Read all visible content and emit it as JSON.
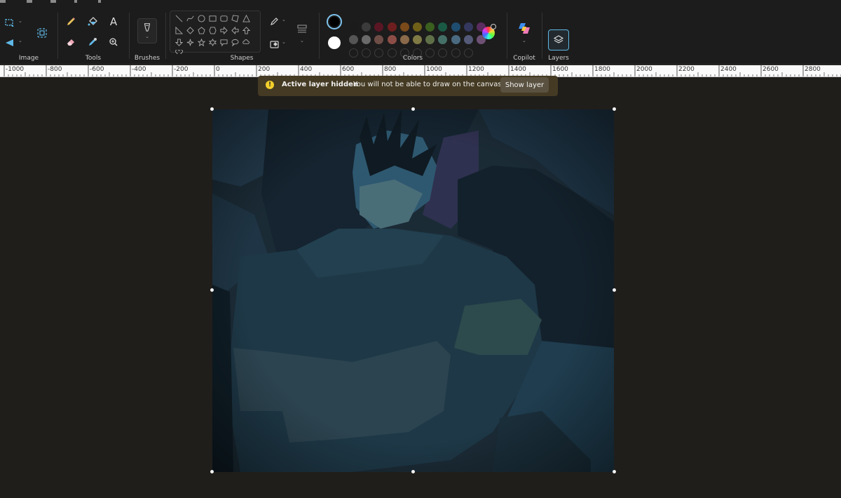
{
  "toolbar": {
    "groups": {
      "image": "Image",
      "tools": "Tools",
      "brushes": "Brushes",
      "shapes": "Shapes",
      "colors": "Colors",
      "copilot": "Copilot",
      "layers": "Layers"
    },
    "text_tool": "A",
    "icons": {
      "select": "select-icon",
      "crop": "crop-icon",
      "image_resize": "image-resize-icon",
      "pencil": "pencil-icon",
      "fill": "fill-bucket-icon",
      "eraser": "eraser-icon",
      "picker": "color-picker-icon",
      "zoom": "zoom-icon",
      "brush": "brush-icon",
      "outline": "shape-outline-icon",
      "shape_fill": "shape-fill-icon",
      "copilot": "copilot-icon",
      "layers": "layers-icon",
      "color_wheel": "edit-colors-icon"
    },
    "colors": {
      "primary": "#000000",
      "secondary": "#ffffff",
      "row1": [
        "#1b1b1b",
        "#3b3b3b",
        "#5a1624",
        "#6e1e1e",
        "#7a4a1a",
        "#6f6018",
        "#3a5f1f",
        "#1a5a45",
        "#1f4d70",
        "#34385f",
        "#5a2c5f"
      ],
      "row2": [
        "#555555",
        "#6a6a6a",
        "#6e4d47",
        "#8c4d46",
        "#8a6a4a",
        "#807a45",
        "#5f7048",
        "#457068",
        "#4a6a80",
        "#545a78",
        "#6e5074"
      ]
    }
  },
  "ruler": {
    "labels": [
      "-1000",
      "-800",
      "-600",
      "-400",
      "-200",
      "0",
      "200",
      "400",
      "600",
      "800",
      "1000",
      "1200",
      "1400",
      "1600",
      "1800",
      "2000",
      "2200",
      "2400",
      "2600",
      "2800"
    ]
  },
  "notice": {
    "title": "Active layer hidden",
    "message": "You will not be able to draw on the canvas",
    "button": "Show layer"
  }
}
